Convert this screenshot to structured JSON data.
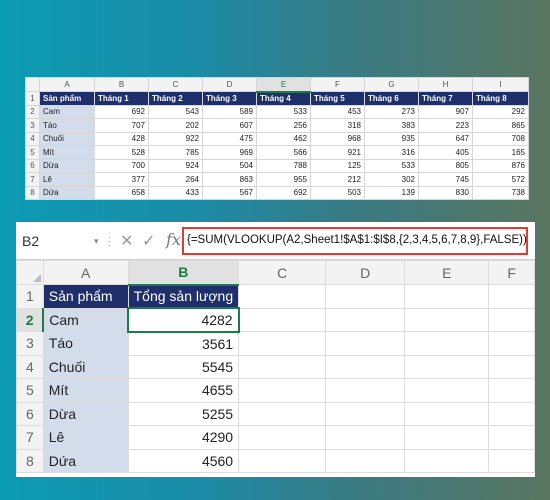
{
  "top_sheet": {
    "columns": [
      "A",
      "B",
      "C",
      "D",
      "E",
      "F",
      "G",
      "H",
      "I"
    ],
    "header": [
      "Sản phẩm",
      "Tháng 1",
      "Tháng 2",
      "Tháng 3",
      "Tháng 4",
      "Tháng 5",
      "Tháng 6",
      "Tháng 7",
      "Tháng 8"
    ],
    "rows": [
      {
        "num": "2",
        "name": "Cam",
        "values": [
          "692",
          "543",
          "589",
          "533",
          "453",
          "273",
          "907",
          "292"
        ]
      },
      {
        "num": "3",
        "name": "Táo",
        "values": [
          "707",
          "202",
          "607",
          "256",
          "318",
          "383",
          "223",
          "865"
        ]
      },
      {
        "num": "4",
        "name": "Chuối",
        "values": [
          "428",
          "922",
          "475",
          "462",
          "968",
          "935",
          "647",
          "708"
        ]
      },
      {
        "num": "5",
        "name": "Mít",
        "values": [
          "528",
          "785",
          "969",
          "566",
          "921",
          "316",
          "405",
          "165"
        ]
      },
      {
        "num": "6",
        "name": "Dừa",
        "values": [
          "700",
          "924",
          "504",
          "788",
          "125",
          "533",
          "805",
          "876"
        ]
      },
      {
        "num": "7",
        "name": "Lê",
        "values": [
          "377",
          "264",
          "863",
          "955",
          "212",
          "302",
          "745",
          "572"
        ]
      },
      {
        "num": "8",
        "name": "Dứa",
        "values": [
          "658",
          "433",
          "567",
          "692",
          "503",
          "139",
          "830",
          "738"
        ]
      }
    ]
  },
  "bottom_sheet": {
    "name_box": "B2",
    "formula": "{=SUM(VLOOKUP(A2,Sheet1!$A$1:$I$8,{2,3,4,5,6,7,8,9},FALSE))}",
    "fx_label": "fx",
    "columns": [
      "A",
      "B",
      "C",
      "D",
      "E",
      "F"
    ],
    "header": [
      "Sản phẩm",
      "Tổng sản lượng"
    ],
    "rows": [
      {
        "num": "2",
        "name": "Cam",
        "total": "4282"
      },
      {
        "num": "3",
        "name": "Táo",
        "total": "3561"
      },
      {
        "num": "4",
        "name": "Chuối",
        "total": "5545"
      },
      {
        "num": "5",
        "name": "Mít",
        "total": "4655"
      },
      {
        "num": "6",
        "name": "Dừa",
        "total": "5255"
      },
      {
        "num": "7",
        "name": "Lê",
        "total": "4290"
      },
      {
        "num": "8",
        "name": "Dứa",
        "total": "4560"
      }
    ]
  },
  "colors": {
    "header_fill": "#1f2f6b",
    "name_fill": "#d3dceb",
    "selection_green": "#1f7a45",
    "formula_border": "#e53935"
  }
}
